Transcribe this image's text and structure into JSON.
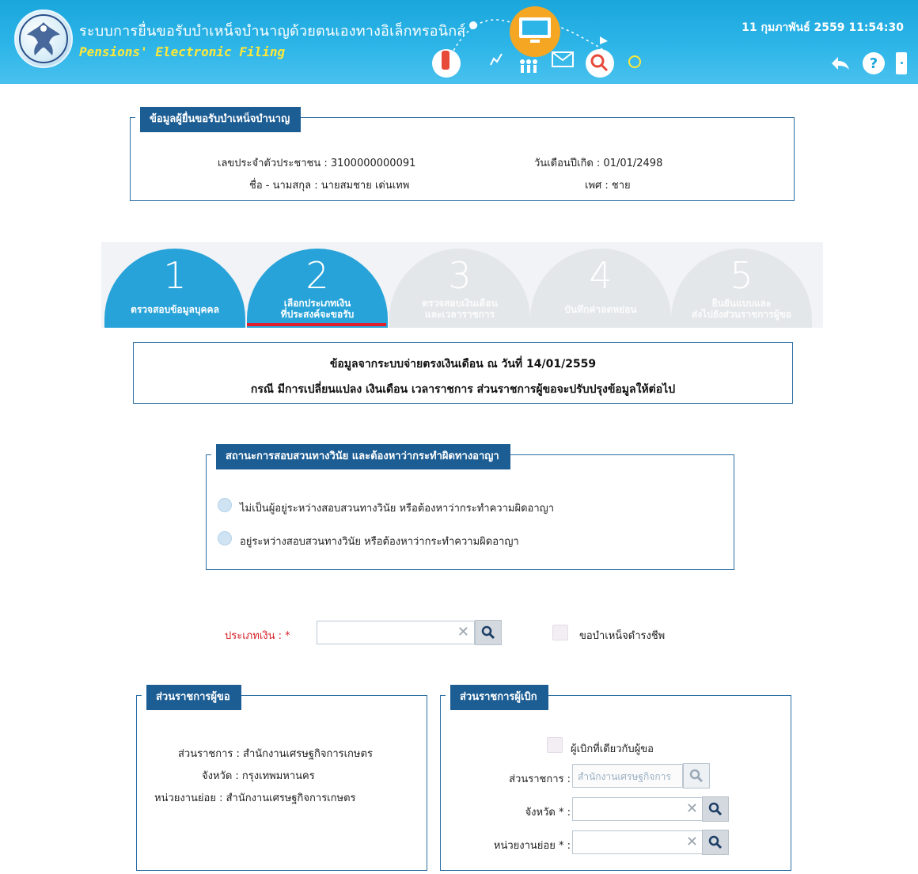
{
  "header": {
    "title_th": "ระบบการยื่นขอรับบำเหน็จบำนาญด้วยตนเองทางอิเล็กทรอนิกส์",
    "title_en": "Pensions' Electronic Filing",
    "datetime": "11 กุมภาพันธ์ 2559 11:54:30",
    "icons": [
      "back-icon",
      "help-icon",
      "logout-icon"
    ],
    "accent_color": "#1aa6dc"
  },
  "applicant": {
    "legend": "ข้อมูลผู้ยื่นขอรับบำเหน็จบำนาญ",
    "id_label": "เลขประจำตัวประชาชน : 3100000000091",
    "name_label": "ชื่อ - นามสกุล : นายสมชาย เด่นเทพ",
    "dob_label": "วันเดือนปีเกิด : 01/01/2498",
    "sex_label": "เพศ : ชาย"
  },
  "steps": [
    {
      "num": "1",
      "line1": "ตรวจสอบข้อมูลบุคคล",
      "line2": "",
      "state": "active"
    },
    {
      "num": "2",
      "line1": "เลือกประเภทเงิน",
      "line2": "ที่ประสงค์จะขอรับ",
      "state": "current"
    },
    {
      "num": "3",
      "line1": "ตรวจสอบเงินเดือน",
      "line2": "และเวลาราชการ",
      "state": "inactive"
    },
    {
      "num": "4",
      "line1": "บันทึกค่าลดหย่อน",
      "line2": "",
      "state": "inactive"
    },
    {
      "num": "5",
      "line1": "ยืนยันแบบและ",
      "line2": "ส่งไปยังส่วนราชการผู้ขอ",
      "state": "inactive"
    }
  ],
  "info": {
    "line1": "ข้อมูลจากระบบจ่ายตรงเงินเดือน ณ วันที่ 14/01/2559",
    "line2": "กรณี มีการเปลี่ยนแปลง เงินเดือน เวลาราชการ ส่วนราชการผู้ขอจะปรับปรุงข้อมูลให้ต่อไป"
  },
  "investigation": {
    "legend": "สถานะการสอบสวนทางวินัย และต้องหาว่ากระทำผิดทางอาญา",
    "options": [
      "ไม่เป็นผู้อยู่ระหว่างสอบสวนทางวินัย หรือต้องหาว่ากระทำความผิดอาญา",
      "อยู่ระหว่างสอบสวนทางวินัย หรือต้องหาว่ากระทำความผิดอาญา"
    ]
  },
  "money_type": {
    "label": "ประเภทเงิน :",
    "required": "*",
    "value": "",
    "survival_label": "ขอบำเหน็จดำรงชีพ"
  },
  "requesting_agency": {
    "legend": "ส่วนราชการผู้ขอ",
    "agency": "ส่วนราชการ : สำนักงานเศรษฐกิจการเกษตร",
    "province": "จังหวัด : กรุงเทพมหานคร",
    "unit": "หน่วยงานย่อย : สำนักงานเศรษฐกิจการเกษตร"
  },
  "disbursing_agency": {
    "legend": "ส่วนราชการผู้เบิก",
    "same_label": "ผู้เบิกที่เดียวกับผู้ขอ",
    "agency_label": "ส่วนราชการ :",
    "agency_value": "สำนักงานเศรษฐกิจการ",
    "province_label": "จังหวัด",
    "unit_label": "หน่วยงานย่อย",
    "required": "* :"
  }
}
